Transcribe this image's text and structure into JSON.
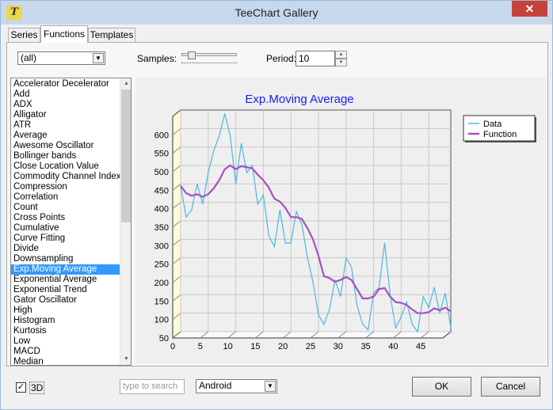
{
  "window": {
    "title": "TeeChart Gallery",
    "app_icon": "T",
    "close_glyph": "✕"
  },
  "tabs": [
    {
      "label": "Series"
    },
    {
      "label": "Functions"
    },
    {
      "label": "Templates"
    }
  ],
  "toolbar": {
    "filter_value": "(all)",
    "samples_label": "Samples:",
    "period_label": "Period:",
    "period_value": "10"
  },
  "functions_list": [
    "Accelerator Decelerator",
    "Add",
    "ADX",
    "Alligator",
    "ATR",
    "Average",
    "Awesome Oscillator",
    "Bollinger bands",
    "Close Location Value",
    "Commodity Channel Index",
    "Compression",
    "Correlation",
    "Count",
    "Cross Points",
    "Cumulative",
    "Curve Fitting",
    "Divide",
    "Downsampling",
    "Exp.Moving Average",
    "Exponential Average",
    "Exponential Trend",
    "Gator Oscillator",
    "High",
    "Histogram",
    "Kurtosis",
    "Low",
    "MACD",
    "Median"
  ],
  "selected_function": "Exp.Moving Average",
  "chart_data": {
    "type": "line",
    "title": "Exp.Moving Average",
    "xlabel": "",
    "ylabel": "",
    "xlim": [
      0,
      49
    ],
    "ylim": [
      50,
      650
    ],
    "x_ticks": [
      0,
      5,
      10,
      15,
      20,
      25,
      30,
      35,
      40,
      45
    ],
    "y_ticks": [
      50,
      100,
      150,
      200,
      250,
      300,
      350,
      400,
      450,
      500,
      550,
      600
    ],
    "grid": true,
    "legend": "top-right",
    "three_d": true,
    "series": [
      {
        "name": "Data",
        "color": "#4cb8e0",
        "values": [
          445,
          360,
          380,
          450,
          395,
          480,
          540,
          580,
          640,
          580,
          450,
          560,
          480,
          500,
          395,
          420,
          310,
          280,
          380,
          290,
          290,
          375,
          340,
          250,
          185,
          95,
          70,
          110,
          190,
          145,
          250,
          225,
          120,
          70,
          55,
          155,
          170,
          290,
          150,
          60,
          90,
          130,
          70,
          50,
          145,
          115,
          170,
          100,
          155,
          60
        ]
      },
      {
        "name": "Function",
        "color": "#a750c0",
        "values": [
          445,
          425,
          418,
          422,
          415,
          422,
          438,
          460,
          490,
          500,
          490,
          498,
          495,
          492,
          475,
          460,
          440,
          410,
          402,
          385,
          360,
          360,
          355,
          330,
          300,
          255,
          200,
          195,
          185,
          190,
          198,
          190,
          165,
          140,
          140,
          145,
          165,
          168,
          145,
          130,
          128,
          122,
          110,
          100,
          100,
          103,
          113,
          108,
          115,
          105
        ]
      }
    ]
  },
  "footer": {
    "three_d_checked_glyph": "✓",
    "three_d_label": "3D",
    "search_placeholder": "type to search",
    "theme_value": "Android",
    "ok_label": "OK",
    "cancel_label": "Cancel"
  }
}
